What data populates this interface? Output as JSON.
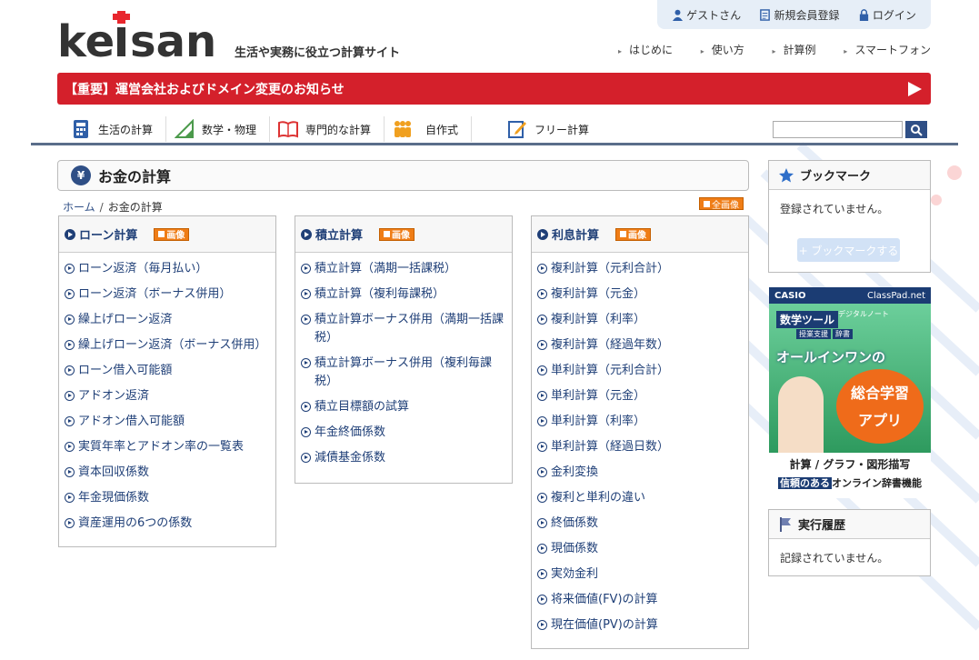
{
  "logo_text": "keisan",
  "tagline": "生活や実務に役立つ計算サイト",
  "userbar": {
    "guest": "ゲストさん",
    "register": "新規会員登録",
    "login": "ログイン"
  },
  "topnav": [
    "はじめに",
    "使い方",
    "計算例",
    "スマートフォン"
  ],
  "notice": "【重要】運営会社およびドメイン変更のお知らせ",
  "catnav": [
    "生活の計算",
    "数学・物理",
    "専門的な計算",
    "自作式",
    "フリー計算"
  ],
  "page_title": "お金の計算",
  "breadcrumb": {
    "home": "ホーム",
    "sep": "/",
    "current": "お金の計算"
  },
  "image_badge": "画像",
  "all_image_badge": "全画像",
  "panels": [
    {
      "title": "ローン計算",
      "items": [
        "ローン返済（毎月払い）",
        "ローン返済（ボーナス併用）",
        "繰上げローン返済",
        "繰上げローン返済（ボーナス併用）",
        "ローン借入可能額",
        "アドオン返済",
        "アドオン借入可能額",
        "実質年率とアドオン率の一覧表",
        "資本回収係数",
        "年金現価係数",
        "資産運用の6つの係数"
      ]
    },
    {
      "title": "積立計算",
      "items": [
        "積立計算（満期一括課税）",
        "積立計算（複利毎課税）",
        "積立計算ボーナス併用（満期一括課税）",
        "積立計算ボーナス併用（複利毎課税）",
        "積立目標額の試算",
        "年金終価係数",
        "減債基金係数"
      ]
    },
    {
      "title": "利息計算",
      "items": [
        "複利計算（元利合計）",
        "複利計算（元金）",
        "複利計算（利率）",
        "複利計算（経過年数）",
        "単利計算（元利合計）",
        "単利計算（元金）",
        "単利計算（利率）",
        "単利計算（経過日数）",
        "金利変換",
        "複利と単利の違い",
        "終価係数",
        "現価係数",
        "実効金利",
        "将来価値(FV)の計算",
        "現在価値(PV)の計算"
      ]
    }
  ],
  "bookmark": {
    "title": "ブックマーク",
    "empty": "登録されていません。",
    "button": "+ ブックマークする"
  },
  "ad": {
    "brand": "CASIO",
    "site": "ClassPad.net",
    "line1": "数学ツール",
    "line1b": "デジタルノート",
    "line1c": "授業支援",
    "line1d": "辞書",
    "line2": "オールインワンの",
    "line3": "総合学習",
    "line4": "アプリ",
    "line5": "計算 / グラフ・図形描写",
    "line6a": "信頼のある",
    "line6b": "オンライン辞書機能"
  },
  "history": {
    "title": "実行履歴",
    "empty": "記録されていません。"
  },
  "colors": {
    "accent": "#1f3f77",
    "notice": "#d4202b",
    "badge": "#ef7d16"
  }
}
